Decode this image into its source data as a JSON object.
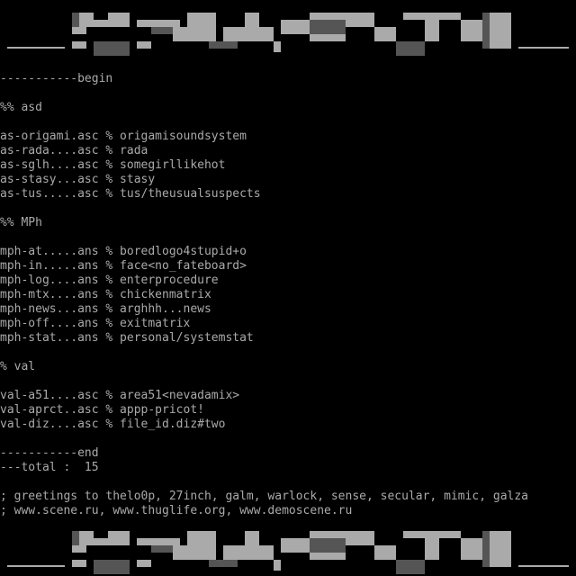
{
  "colors": {
    "background": "#000000",
    "text": "#aaaaaa",
    "logo_light": "#aaaaaa",
    "logo_dark": "#555555"
  },
  "banner": {
    "icon": "ascii-block-logo"
  },
  "lines": [
    "-----------begin",
    "",
    "%% asd",
    "",
    "as-origami.asc % origamisoundsystem",
    "as-rada....asc % rada",
    "as-sglh....asc % somegirllikehot",
    "as-stasy...asc % stasy",
    "as-tus.....asc % tus/theusualsuspects",
    "",
    "%% MPh",
    "",
    "mph-at.....ans % boredlogo4stupid+o",
    "mph-in.....ans % face<no_fateboard>",
    "mph-log....ans % enterprocedure",
    "mph-mtx....ans % chickenmatrix",
    "mph-news...ans % arghhh...news",
    "mph-off....ans % exitmatrix",
    "mph-stat...ans % personal/systemstat",
    "",
    "% val",
    "",
    "val-a51....asc % area51<nevadamix>",
    "val-aprct..asc % appp-pricot!",
    "val-diz....asc % file_id.diz#two",
    "",
    "-----------end",
    "---total :  15",
    "",
    "; greetings to thelo0p, 27inch, galm, warlock, sense, secular, mimic, galza",
    "; www.scene.ru, www.thuglife.org, www.demoscene.ru"
  ]
}
